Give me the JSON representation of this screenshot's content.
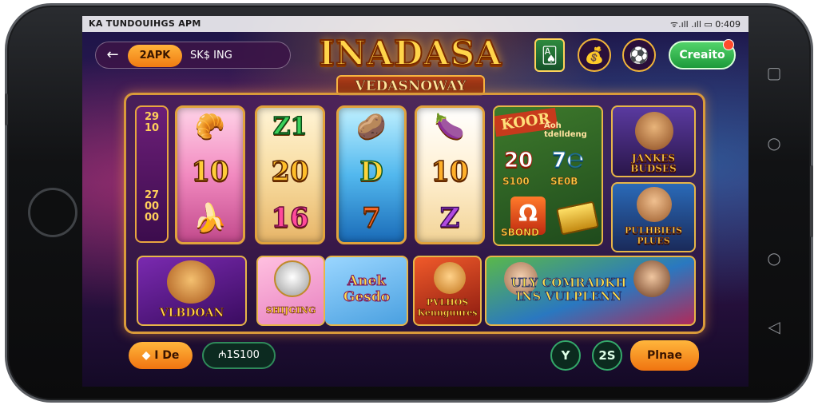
{
  "status_bar": {
    "app_label": "KA TUNDOUIHGS APM",
    "right_info": "ᯤ.ıll .ıll ▭ 0:409"
  },
  "top_bar": {
    "back_icon": "arrow-left",
    "apk_label": "2APK",
    "search_text": "SK$ ING"
  },
  "logo": {
    "title": "INADASA",
    "subtitle": "VEDASNOWAY"
  },
  "top_icons": [
    {
      "name": "cards-icon",
      "glyph": "🂡"
    },
    {
      "name": "coin-bag-icon",
      "glyph": "💰"
    },
    {
      "name": "ball-icon",
      "glyph": "⚽"
    }
  ],
  "create_button": {
    "label": "Creaito"
  },
  "paytable": {
    "values": [
      "29",
      "10",
      "",
      "",
      "",
      "",
      "",
      "27",
      "00",
      "00"
    ]
  },
  "reels": [
    {
      "top": "🥐",
      "mid": "10",
      "bot": "🍌"
    },
    {
      "top": "Z1",
      "mid": "20",
      "bot": "16"
    },
    {
      "top": "🥔",
      "mid": "D",
      "bot": "7"
    },
    {
      "top": "🍆",
      "mid": "10",
      "bot": "Z"
    }
  ],
  "promo": {
    "banner": "KOOR",
    "subtitle": "Aoh tdelldeng",
    "left_value": "20",
    "right_value": "7℮",
    "left_bonus": "S100",
    "right_bonus": "SE0B",
    "card_glyph": "Ω",
    "bottom_label": "SBOND"
  },
  "side_cards": [
    {
      "label": "JANKES BUDSES"
    },
    {
      "label": "PULHBIEIS PLUES"
    }
  ],
  "tiles": [
    {
      "label": "VLBDOAN"
    },
    {
      "label": "SHIJGING"
    },
    {
      "label": "Anek Gesdo"
    },
    {
      "label": "PVLHOS Kennguures"
    },
    {
      "label": "ULY COMRADKH INS VULPLENN"
    }
  ],
  "bottom_bar": {
    "left_pill": "I De",
    "balance": "₼1S100",
    "round_1": "Y",
    "round_2": "2S",
    "play_button": "Plnae"
  }
}
